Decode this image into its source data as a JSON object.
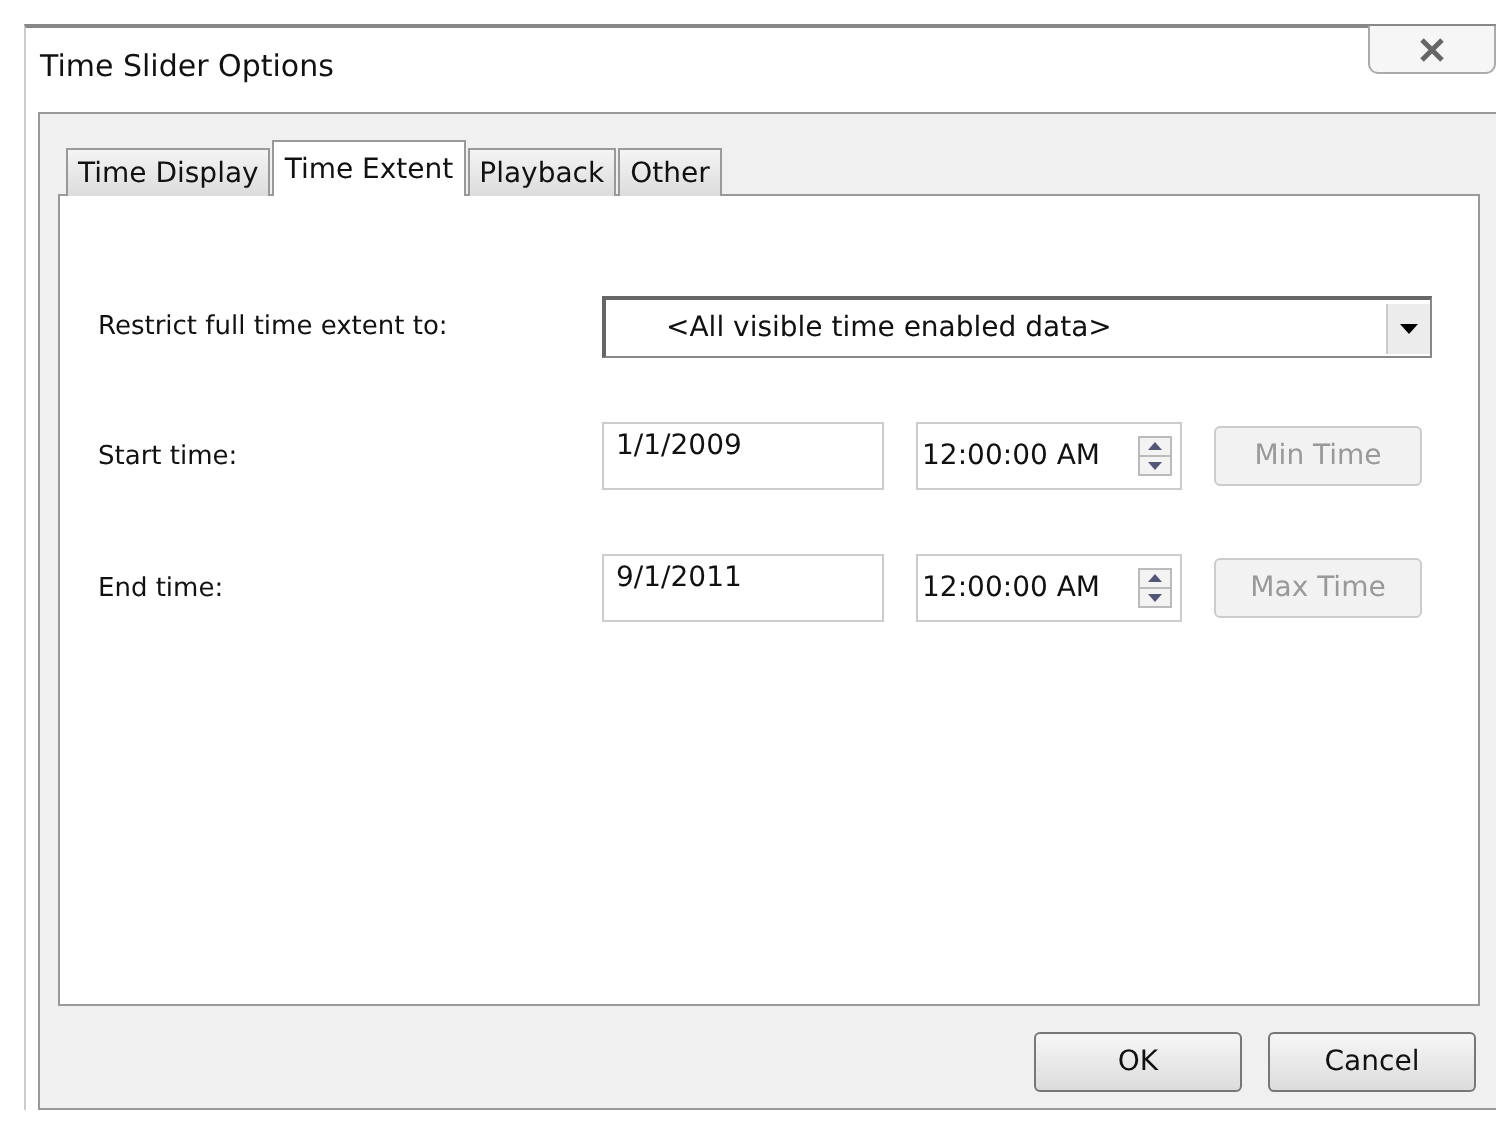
{
  "window": {
    "title": "Time Slider Options"
  },
  "tabs": [
    {
      "label": "Time Display",
      "selected": false
    },
    {
      "label": "Time Extent",
      "selected": true
    },
    {
      "label": "Playback",
      "selected": false
    },
    {
      "label": "Other",
      "selected": false
    }
  ],
  "restrict": {
    "label": "Restrict full time extent to:",
    "value": "<All visible time enabled data>"
  },
  "time_rows": [
    {
      "label": "Start time:",
      "date": "1/1/2009",
      "time": "12:00:00 AM",
      "button": "Min Time",
      "disabled": true
    },
    {
      "label": "End time:",
      "date": "9/1/2011",
      "time": "12:00:00 AM",
      "button": "Max Time",
      "disabled": true
    }
  ],
  "buttons": [
    "OK",
    "Cancel"
  ]
}
